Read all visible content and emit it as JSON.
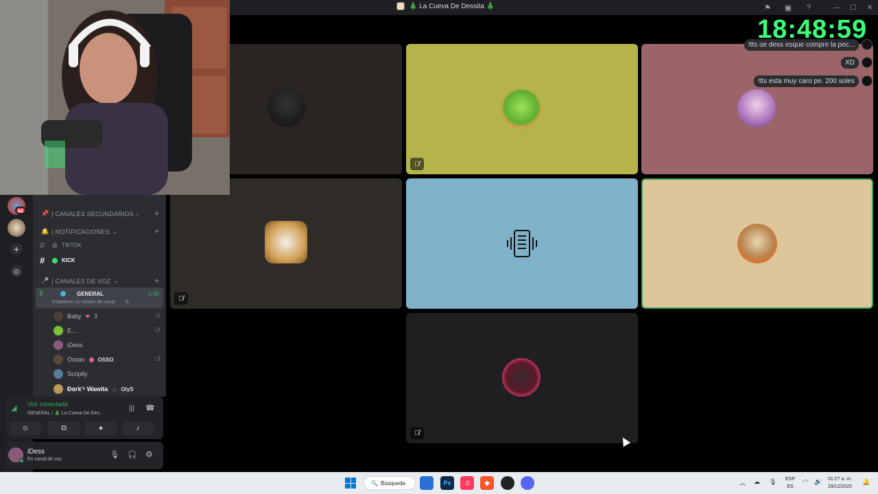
{
  "window": {
    "title": "🎄 La Cueva De Dessita 🎄"
  },
  "overlay": {
    "clock": "18:48:59",
    "chat_bubbles": [
      "!tts oe dess esque compre la pec...",
      "XD",
      "!tts esta muy caro pe. 200 soles"
    ]
  },
  "server_rail": {
    "badge": "62"
  },
  "channel_list": {
    "categories": {
      "secondary": "| CANALES SECUNDARIOS",
      "notifications": "| NOTIFICACIONES",
      "voice": "| CANALES DE VOZ"
    },
    "text_channels": [
      {
        "name": "TIKTOK"
      },
      {
        "name": "KICK"
      }
    ],
    "voice_channel": {
      "name": "GENERAL",
      "time": "2:36",
      "status_placeholder": "Establece un estado de canal",
      "members": [
        {
          "name": "Baby",
          "tag": "3",
          "muted": true
        },
        {
          "name": "E...",
          "tag": "",
          "muted": true
        },
        {
          "name": "iDess",
          "tag": "",
          "muted": false
        },
        {
          "name": "Ossas",
          "tag": "OSSO",
          "muted": true
        },
        {
          "name": "Scriptly",
          "tag": "",
          "muted": false
        },
        {
          "name": "Ðαrk'ˢ Wawita",
          "tag": "OlyS",
          "muted": false
        }
      ]
    }
  },
  "voice_panel": {
    "status": "Voz conectada",
    "location": "GENERAL / 🎄 La Cueva De Des..."
  },
  "user": {
    "name": "iDess",
    "status": "En canal de voz"
  },
  "taskbar": {
    "search": "Búsqueda",
    "lang_top": "ESP",
    "lang_bottom": "ES",
    "time": "01:27 a. m.",
    "date": "29/12/2025"
  },
  "colors": {
    "clock": "#3cff7a",
    "tile_olive": "#b5b44a",
    "tile_rose": "#9a6468",
    "tile_blue": "#7fb1c8",
    "tile_tan": "#dcc69a",
    "speaking_outline": "#3ba55d"
  }
}
